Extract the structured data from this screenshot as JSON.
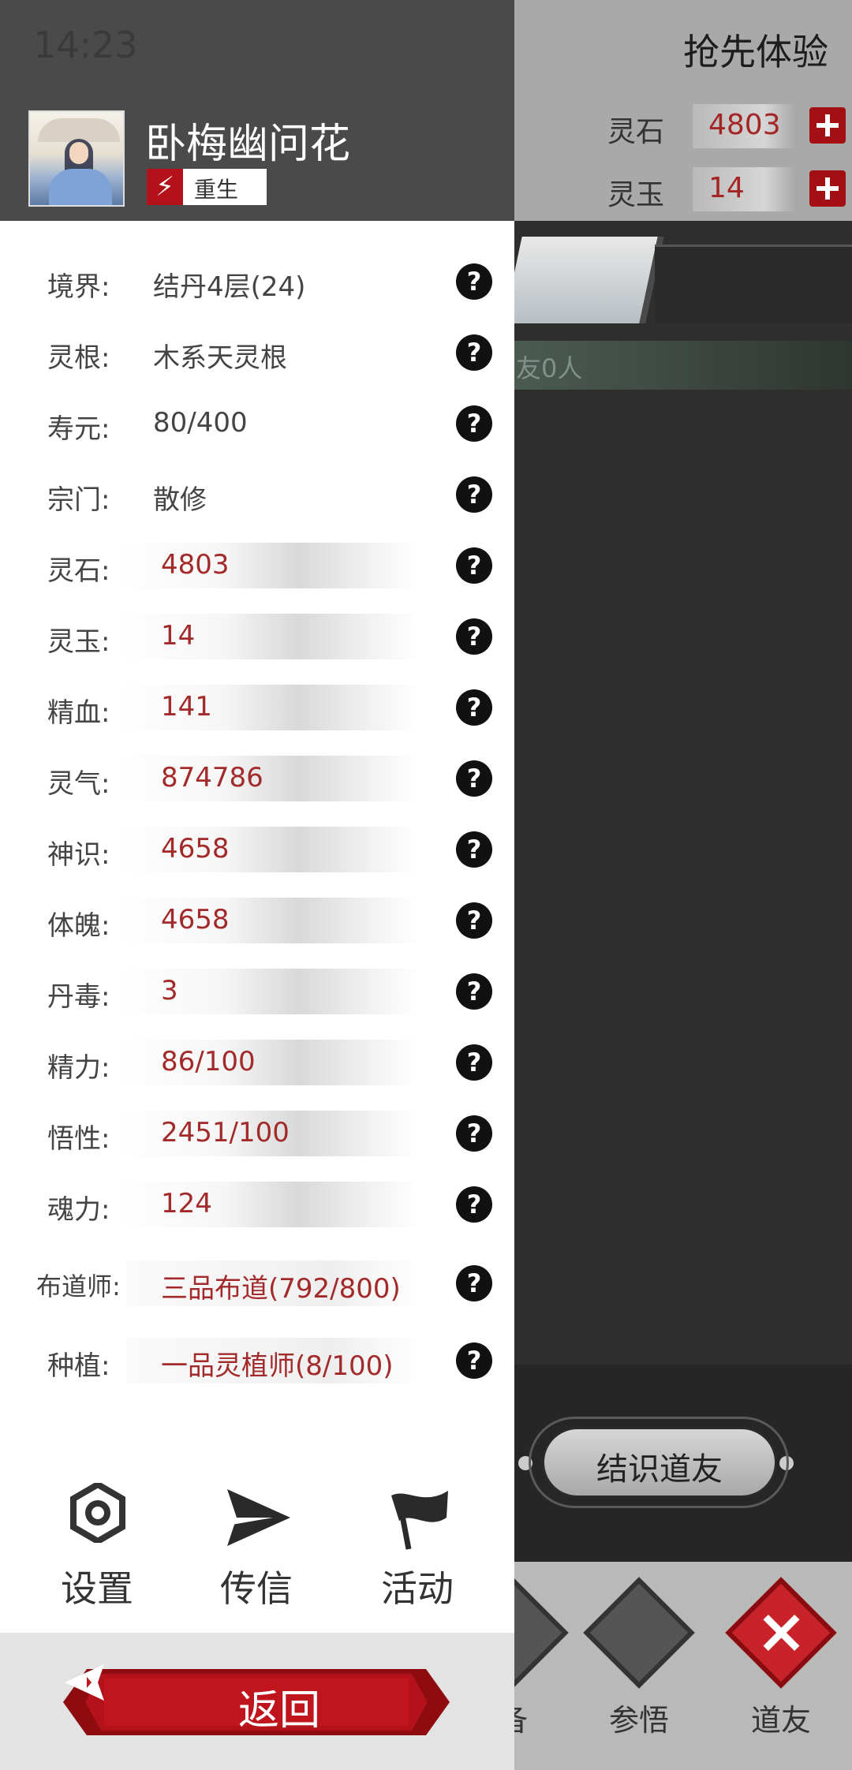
{
  "status": {
    "time": "14:23"
  },
  "background": {
    "early_access": "抢先体验",
    "currencies": [
      {
        "label": "灵石",
        "value": "4803"
      },
      {
        "label": "灵玉",
        "value": "14"
      }
    ],
    "friend_count_partial": "友0人",
    "meet_friend_button": "结识道友",
    "nav": [
      {
        "label": "备",
        "icon": "cultivate-diamond-icon"
      },
      {
        "label": "参悟",
        "icon": "book-diamond-icon"
      },
      {
        "label": "道友",
        "icon": "close-diamond-icon"
      }
    ]
  },
  "profile": {
    "name": "卧梅幽问花",
    "badge": "重生",
    "badge_icon": "lightning-icon"
  },
  "stats": [
    {
      "label": "境界:",
      "value": "结丹4层(24)",
      "style": "plain"
    },
    {
      "label": "灵根:",
      "value": "木系天灵根",
      "style": "plain"
    },
    {
      "label": "寿元:",
      "value": "80/400",
      "style": "plain"
    },
    {
      "label": "宗门:",
      "value": "散修",
      "style": "plain"
    },
    {
      "label": "灵石:",
      "value": "4803",
      "style": "bar"
    },
    {
      "label": "灵玉:",
      "value": "14",
      "style": "bar"
    },
    {
      "label": "精血:",
      "value": "141",
      "style": "bar"
    },
    {
      "label": "灵气:",
      "value": "874786",
      "style": "bar"
    },
    {
      "label": "神识:",
      "value": "4658",
      "style": "bar"
    },
    {
      "label": "体魄:",
      "value": "4658",
      "style": "bar"
    },
    {
      "label": "丹毒:",
      "value": "3",
      "style": "bar"
    },
    {
      "label": "精力:",
      "value": "86/100",
      "style": "bar"
    },
    {
      "label": "悟性:",
      "value": "2451/100",
      "style": "bar"
    },
    {
      "label": "魂力:",
      "value": "124",
      "style": "bar"
    },
    {
      "label": "布道师:",
      "value": "三品布道(792/800)",
      "style": "bar2"
    },
    {
      "label": "种植:",
      "value": "一品灵植师(8/100)",
      "style": "bar2"
    }
  ],
  "help_symbol": "?",
  "menu": [
    {
      "label": "设置",
      "icon": "gear-icon"
    },
    {
      "label": "传信",
      "icon": "send-icon"
    },
    {
      "label": "活动",
      "icon": "flag-icon"
    }
  ],
  "back_button": {
    "label": "返回",
    "icon": "back-arrow-icon"
  },
  "colors": {
    "accent_red": "#a30f12",
    "value_red": "#a32a2a",
    "header_gray": "#4a4a4a"
  }
}
